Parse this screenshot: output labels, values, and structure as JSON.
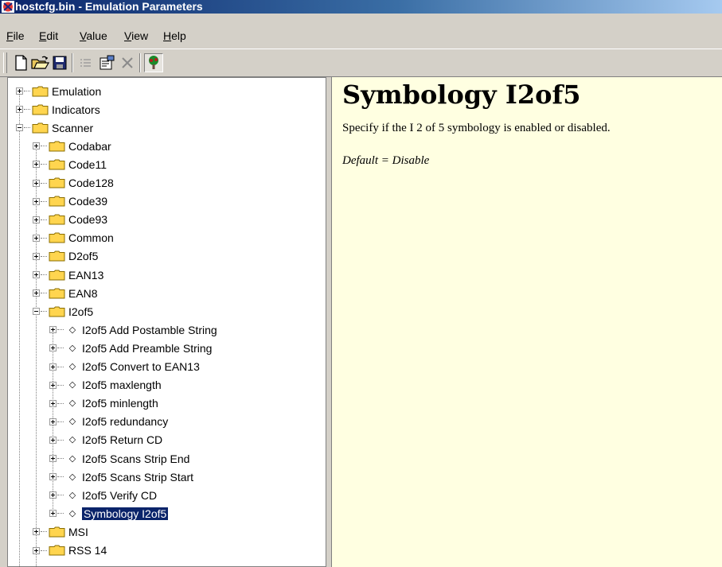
{
  "window": {
    "title": "hostcfg.bin - Emulation Parameters"
  },
  "menu": [
    {
      "key": "F",
      "rest": "ile"
    },
    {
      "key": "E",
      "rest": "dit"
    },
    {
      "key": "V",
      "rest": "alue"
    },
    {
      "key": "V",
      "rest": "iew"
    },
    {
      "key": "H",
      "rest": "elp"
    }
  ],
  "toolbar": {
    "icons": [
      "new-icon",
      "open-icon",
      "save-icon",
      "list-icon",
      "properties-icon",
      "delete-icon",
      "tree-icon"
    ]
  },
  "tree": {
    "items": [
      {
        "label": "Emulation",
        "type": "folder",
        "level": 0,
        "expanded": false
      },
      {
        "label": "Indicators",
        "type": "folder",
        "level": 0,
        "expanded": false
      },
      {
        "label": "Scanner",
        "type": "folder",
        "level": 0,
        "expanded": true
      },
      {
        "label": "Codabar",
        "type": "folder",
        "level": 1,
        "expanded": false
      },
      {
        "label": "Code11",
        "type": "folder",
        "level": 1,
        "expanded": false
      },
      {
        "label": "Code128",
        "type": "folder",
        "level": 1,
        "expanded": false
      },
      {
        "label": "Code39",
        "type": "folder",
        "level": 1,
        "expanded": false
      },
      {
        "label": "Code93",
        "type": "folder",
        "level": 1,
        "expanded": false
      },
      {
        "label": "Common",
        "type": "folder",
        "level": 1,
        "expanded": false
      },
      {
        "label": "D2of5",
        "type": "folder",
        "level": 1,
        "expanded": false
      },
      {
        "label": "EAN13",
        "type": "folder",
        "level": 1,
        "expanded": false
      },
      {
        "label": "EAN8",
        "type": "folder",
        "level": 1,
        "expanded": false
      },
      {
        "label": "I2of5",
        "type": "folder",
        "level": 1,
        "expanded": true
      },
      {
        "label": "I2of5 Add Postamble String",
        "type": "param",
        "level": 2
      },
      {
        "label": "I2of5 Add Preamble String",
        "type": "param",
        "level": 2
      },
      {
        "label": "I2of5 Convert to EAN13",
        "type": "param",
        "level": 2
      },
      {
        "label": "I2of5 maxlength",
        "type": "param",
        "level": 2
      },
      {
        "label": "I2of5 minlength",
        "type": "param",
        "level": 2
      },
      {
        "label": "I2of5 redundancy",
        "type": "param",
        "level": 2
      },
      {
        "label": "I2of5 Return CD",
        "type": "param",
        "level": 2
      },
      {
        "label": "I2of5 Scans Strip End",
        "type": "param",
        "level": 2
      },
      {
        "label": "I2of5 Scans Strip Start",
        "type": "param",
        "level": 2
      },
      {
        "label": "I2of5 Verify CD",
        "type": "param",
        "level": 2
      },
      {
        "label": "Symbology I2of5",
        "type": "param",
        "level": 2,
        "selected": true
      },
      {
        "label": "MSI",
        "type": "folder",
        "level": 1,
        "expanded": false
      },
      {
        "label": "RSS 14",
        "type": "folder",
        "level": 1,
        "expanded": false
      }
    ]
  },
  "content": {
    "title": "Symbology I2of5",
    "description": "Specify if the I 2 of 5 symbology is enabled or disabled.",
    "default": "Default = Disable"
  },
  "colors": {
    "titlebar": "#0a246a",
    "content_bg": "#ffffe1",
    "selection": "#0a246a",
    "folder": "#ffd54f"
  }
}
